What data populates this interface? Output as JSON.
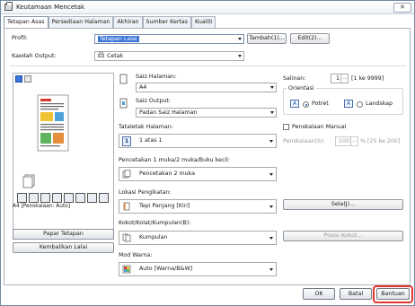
{
  "window": {
    "title": "Keutamaan Mencetak",
    "close_glyph": "✕"
  },
  "tabs": [
    {
      "label": "Tetapan Asas"
    },
    {
      "label": "Persediaan Halaman"
    },
    {
      "label": "Akhiran"
    },
    {
      "label": "Sumber Kertas"
    },
    {
      "label": "Kualiti"
    }
  ],
  "profile": {
    "label": "Profil:",
    "value": "Tetapan Lalai",
    "add_button": "Tambah(1)...",
    "edit_button": "Edit(2)..."
  },
  "output_method": {
    "label": "Kaedah Output:",
    "value": "Cetak"
  },
  "page_size": {
    "label": "Saiz Halaman:",
    "value": "A4"
  },
  "output_size": {
    "label": "Saiz Output:",
    "value": "Padan Saiz Halaman"
  },
  "copies": {
    "label": "Salinan:",
    "value": "1",
    "range": "[1 ke 9999]"
  },
  "orientation": {
    "label": "Orientasi",
    "portrait": "Potret",
    "landscape": "Landskap",
    "portrait_icon_letter": "A",
    "landscape_icon_letter": "A"
  },
  "page_layout": {
    "label": "Tataletak Halaman:",
    "value": "1 atas 1",
    "icon_text": "1"
  },
  "manual_scaling": {
    "label": "Penskalaan Manual",
    "checked": false
  },
  "scaling": {
    "label": "Penskalaan(S):",
    "value": "100",
    "range": "% [25 ke 200]"
  },
  "duplex": {
    "label": "Pencetakan 1 muka/2 muka/Buku kecil:",
    "value": "Pencetakan 2 muka"
  },
  "binding": {
    "label": "Lokasi Pengikatan:",
    "value": "Tepi Panjang [Kiri]",
    "gutter_button": "Sela(J)..."
  },
  "collate": {
    "label": "Kokot/Kolat/Kumpulan(B):",
    "value": "Kumpulan",
    "staple_button": "Posisi Kokot..."
  },
  "color_mode": {
    "label": "Mod Warna:",
    "value": "Auto [Warna/B&W]"
  },
  "preview": {
    "caption": "A4 [Penskalaan: Auto]"
  },
  "left_buttons": {
    "view_settings": "Papar Tetapan",
    "restore_defaults": "Kembalikan Lalai"
  },
  "footer": {
    "ok": "OK",
    "cancel": "Batal",
    "help": "Bantuan"
  },
  "icons": {
    "printer": "printer-icon",
    "page": "page-icon",
    "layout": "layout-icon"
  },
  "colors": {
    "focus_ring": "#e0352b",
    "selected_highlight": "#3a76d8"
  }
}
